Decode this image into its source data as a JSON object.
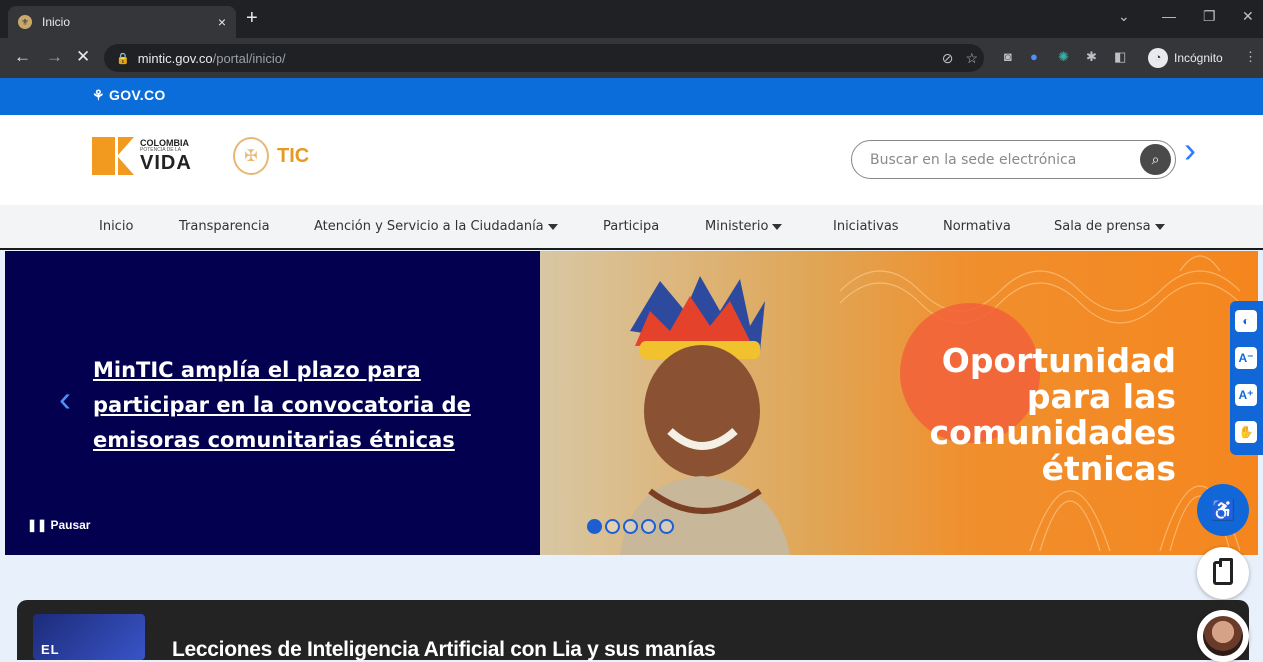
{
  "browser": {
    "tab_title": "Inicio",
    "tab_close": "×",
    "new_tab": "+",
    "url_domain": "mintic.gov.co",
    "url_path": "/portal/inicio/",
    "incognito_label": "Incógnito"
  },
  "govbar": {
    "logo_text": "GOV.CO"
  },
  "header": {
    "logo_colombia_line1": "COLOMBIA",
    "logo_colombia_line2": "POTENCIA DE LA",
    "logo_colombia_line3": "VIDA",
    "logo_tic": "TIC",
    "search_placeholder": "Buscar en la sede electrónica"
  },
  "nav": {
    "items": [
      {
        "label": "Inicio",
        "dropdown": false
      },
      {
        "label": "Transparencia",
        "dropdown": false
      },
      {
        "label": "Atención y Servicio a la Ciudadanía",
        "dropdown": true
      },
      {
        "label": "Participa",
        "dropdown": false
      },
      {
        "label": "Ministerio",
        "dropdown": true
      },
      {
        "label": "Iniciativas",
        "dropdown": false
      },
      {
        "label": "Normativa",
        "dropdown": false
      },
      {
        "label": "Sala de prensa",
        "dropdown": true
      }
    ]
  },
  "hero": {
    "headline": "MinTIC amplía el plazo para participar en la convocatoria de emisoras comunitarias étnicas",
    "pause_label": "Pausar",
    "slogan_line1": "Oportunidad",
    "slogan_line2": "para las",
    "slogan_line3": "comunidades",
    "slogan_line4": "étnicas",
    "slide_count": 5,
    "active_slide": 1
  },
  "a11y": {
    "buttons": [
      "contrast-icon",
      "decrease-font-icon",
      "increase-font-icon",
      "sign-language-icon"
    ],
    "contrast_label": "◐",
    "decrease_label": "A⁻",
    "increase_label": "A⁺",
    "sign_label": "✋"
  },
  "card": {
    "thumb_text": "EL ALGORITMO",
    "title": "Lecciones de Inteligencia Artificial con Lia y sus manías"
  },
  "colors": {
    "gov_blue": "#0b6dd9",
    "hero_navy": "#02004f",
    "hero_orange": "#f5861e"
  }
}
